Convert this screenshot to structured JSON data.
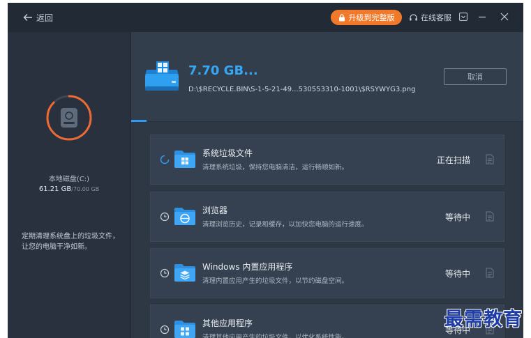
{
  "titlebar": {
    "back_label": "返回",
    "upgrade_label": "升级到完整版",
    "support_label": "在线客服"
  },
  "disk": {
    "name": "本地磁盘(C:)",
    "used": "61.21 GB",
    "total": "/70.00 GB",
    "used_fraction": 0.874
  },
  "tip": "定期清理系统盘上的垃圾文件，让您的电脑干净如新。",
  "scan": {
    "size": "7.70 GB...",
    "path": "D:\\$RECYCLE.BIN\\S-1-5-21-49...530553310-1001\\$RSYWYG3.png",
    "cancel_label": "取消"
  },
  "categories": [
    {
      "title": "系统垃圾文件",
      "desc": "清理系统垃圾，保持您电脑清洁，运行畅顺如新。",
      "status": "正在扫描",
      "icon": "windows-folder-icon"
    },
    {
      "title": "浏览器",
      "desc": "清理浏览历史，记录和缓存，以加快您电脑的运行速度。",
      "status": "等待中",
      "icon": "browser-folder-icon"
    },
    {
      "title": "Windows 内置应用程序",
      "desc": "清理内置应用产生的垃圾文件，以节约磁盘空间。",
      "status": "等待中",
      "icon": "stack-folder-icon"
    },
    {
      "title": "其他应用程序",
      "desc": "清理其他应用产生的垃圾文件，以优化系统性能。",
      "status": "等待中",
      "icon": "apps-folder-icon"
    }
  ],
  "watermark": "最需教育",
  "colors": {
    "accent": "#2d9bf0",
    "upgrade": "#f07a2a",
    "ring": "#ee6a35",
    "panel_dark": "#222a35",
    "card": "#354150"
  }
}
